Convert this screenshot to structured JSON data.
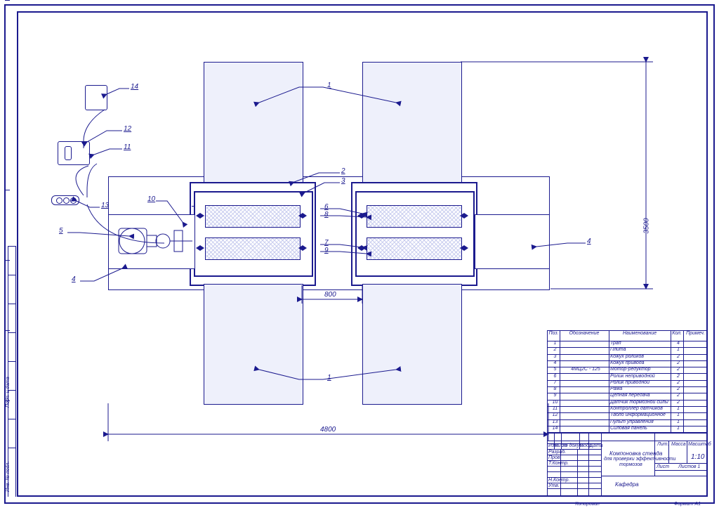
{
  "callouts": {
    "c1": "1",
    "c2": "2",
    "c3": "3",
    "c4": "4",
    "c5": "5",
    "c6": "6",
    "c7": "7",
    "c8": "8",
    "c9": "9",
    "c10": "10",
    "c11": "11",
    "c12": "12",
    "c13": "13",
    "c14": "14"
  },
  "dims": {
    "width": "4800",
    "height": "3500",
    "gap": "800"
  },
  "parts_header": {
    "c1": "Поз.",
    "c2": "Обозначение",
    "c3": "Наименование",
    "c4": "Кол.",
    "c5": "Примеч."
  },
  "parts": [
    {
      "p": "1",
      "o": "",
      "n": "Трап",
      "k": "4"
    },
    {
      "p": "2",
      "o": "",
      "n": "Плита",
      "k": "1"
    },
    {
      "p": "3",
      "o": "",
      "n": "Кожух роликов",
      "k": "2"
    },
    {
      "p": "4",
      "o": "",
      "n": "Кожух привода",
      "k": "2"
    },
    {
      "p": "5",
      "o": "4МЦ2С - 125",
      "n": "Мотор-редуктор",
      "k": "2"
    },
    {
      "p": "6",
      "o": "",
      "n": "Ролик неприводной",
      "k": "2"
    },
    {
      "p": "7",
      "o": "",
      "n": "Ролик приводной",
      "k": "2"
    },
    {
      "p": "8",
      "o": "",
      "n": "Рама",
      "k": "2"
    },
    {
      "p": "9",
      "o": "",
      "n": "Цепная передача",
      "k": "2"
    },
    {
      "p": "10",
      "o": "",
      "n": "Датчик тормозной силы",
      "k": "2"
    },
    {
      "p": "11",
      "o": "",
      "n": "Контроллер датчиков",
      "k": "1"
    },
    {
      "p": "12",
      "o": "",
      "n": "Табло информационное",
      "k": "1"
    },
    {
      "p": "13",
      "o": "",
      "n": "Пульт управления",
      "k": "1"
    },
    {
      "p": "14",
      "o": "",
      "n": "Силовая панель",
      "k": "1"
    }
  ],
  "titleblock": {
    "left_rows": {
      "r1": "Изм.",
      "r2": "Лист",
      "r3": "№ докум.",
      "r4": "Подп.",
      "r5": "Дата",
      "a": "Разраб.",
      "b": "Пров.",
      "c": "Т.Контр.",
      "d": "Н.Контр.",
      "e": "Утв."
    },
    "title1": "Компоновка стенда",
    "title2": "для проверки эффективности",
    "title3": "тормозов",
    "right": {
      "lit": "Лит.",
      "mass": "Масса",
      "scale": "Масштаб",
      "scale_v": "1:10",
      "sheet": "Лист",
      "sheets": "Листов   1"
    },
    "org": "Кафедра",
    "fmt": "Формат    А1",
    "cpy": "Копировал"
  },
  "side_stamps": {
    "s1": "Инв. № подл.",
    "s2": "Подп. и дата"
  }
}
